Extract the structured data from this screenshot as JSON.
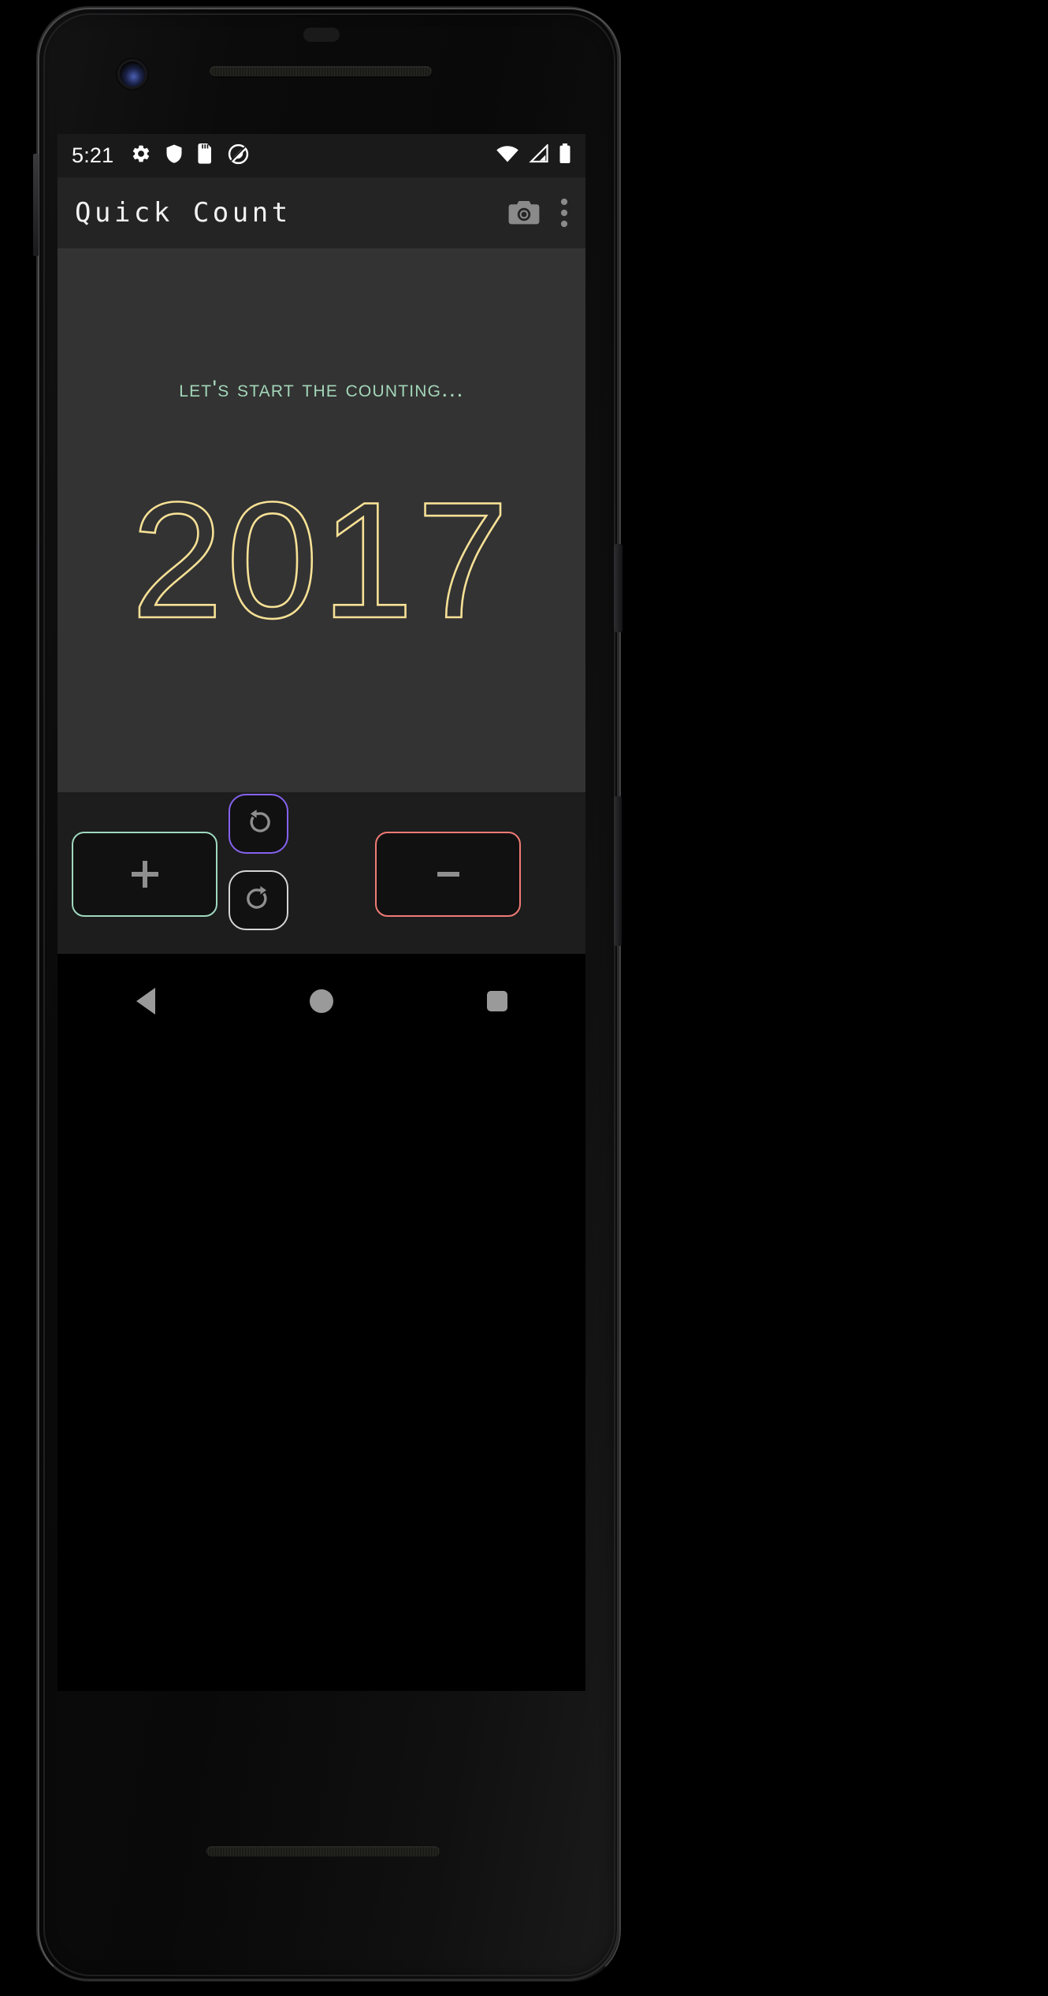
{
  "device": {
    "hardware": {
      "front_camera": "front-camera-lens",
      "earpiece": "earpiece-speaker",
      "bottom_speaker": "bottom-speaker-grille",
      "power_button": "power-button",
      "volume_button": "volume-button"
    }
  },
  "status_bar": {
    "time": "5:21",
    "left_icons": [
      {
        "name": "gear-icon",
        "label": "settings"
      },
      {
        "name": "shield-icon",
        "label": "security"
      },
      {
        "name": "sd-card-icon",
        "label": "sd-card"
      },
      {
        "name": "do-not-disturb-icon",
        "label": "do-not-disturb"
      }
    ],
    "right_icons": [
      {
        "name": "wifi-icon",
        "label": "wifi-full"
      },
      {
        "name": "cellular-signal-icon",
        "label": "signal"
      },
      {
        "name": "battery-icon",
        "label": "battery-full"
      }
    ]
  },
  "app_bar": {
    "title": "Quick Count",
    "actions": [
      {
        "name": "camera-icon",
        "label": "camera"
      },
      {
        "name": "overflow-menu-icon",
        "label": "more-options"
      }
    ]
  },
  "main": {
    "hint_text": "Let's start the counting...",
    "counter_value": "2017"
  },
  "controls": {
    "increment_label": "+",
    "decrement_label": "−",
    "undo_label": "undo",
    "redo_label": "redo"
  },
  "nav_bar": {
    "back_label": "back",
    "home_label": "home",
    "recents_label": "recents"
  },
  "colors": {
    "screen_bg": "#333333",
    "app_bar_bg": "#242424",
    "status_bar_bg": "#1a1a1a",
    "controls_bg": "#1d1d1d",
    "hint_green": "#a3d6b9",
    "counter_yellow": "#f7e196",
    "plus_border": "#9fd8c0",
    "minus_border": "#f07b75",
    "undo_border": "#8462ef",
    "redo_border": "#d5d5d5",
    "icon_gray": "#8f8f8f",
    "nav_icon_gray": "#9a9a9a"
  }
}
